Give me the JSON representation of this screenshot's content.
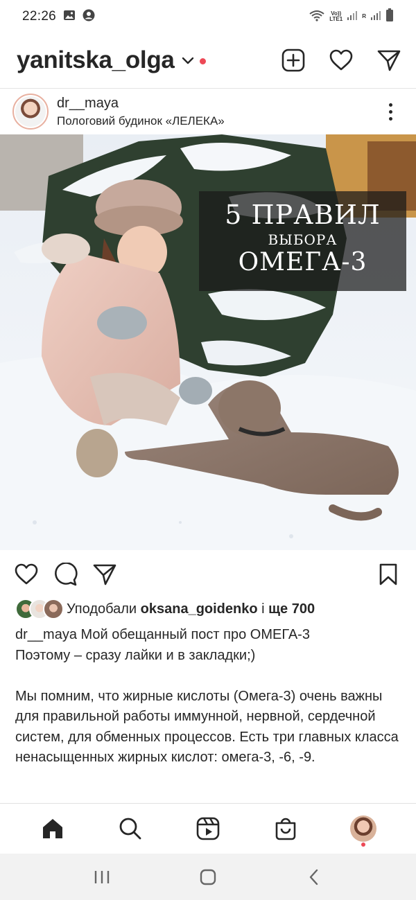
{
  "status_bar": {
    "time": "22:26",
    "network_label_top": "Vo))",
    "network_label_bottom": "LTE1",
    "sim_label": "R"
  },
  "header": {
    "username": "yanitska_olga"
  },
  "post": {
    "author": "dr__maya",
    "location": "Пологовий будинок «ЛЕЛЕКА»",
    "image_text": {
      "line1": "5 ПРАВИЛ",
      "line2": "ВЫБОРА",
      "line3": "ОМЕГА-3"
    },
    "likes": {
      "prefix": "Уподобали ",
      "user": "oksana_goidenko",
      "middle": " і ",
      "more": "ще 700"
    },
    "caption": {
      "author": "dr__maya",
      "line1": " Мой обещанный пост про ОМЕГА-3",
      "line2": "Поэтому – сразу лайки и в закладки;)",
      "paragraph": "Мы помним, что жирные кислоты (Омега-3) очень важны для правильной работы иммунной, нервной, сердечной систем, для обменных процессов. Есть три главных класса ненасыщенных жирных кислот: омега-3, -6, -9."
    }
  },
  "colors": {
    "accent_red": "#ed4956",
    "text": "#262626",
    "overlay": "#191919"
  },
  "icons": {
    "header": [
      "new-post-icon",
      "heart-icon",
      "direct-message-icon"
    ],
    "actions": [
      "like-icon",
      "comment-icon",
      "share-icon",
      "save-icon"
    ],
    "nav": [
      "home-icon",
      "search-icon",
      "reels-icon",
      "shop-icon",
      "profile-icon"
    ],
    "system": [
      "recent-apps-icon",
      "home-button-icon",
      "back-icon"
    ]
  }
}
